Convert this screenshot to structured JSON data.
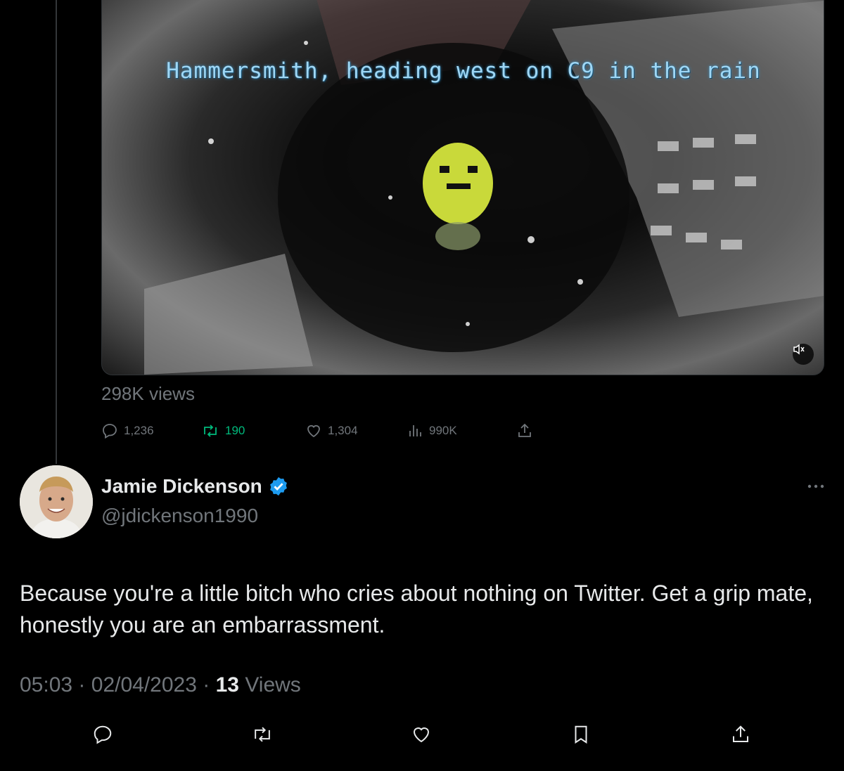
{
  "video": {
    "caption": "Hammersmith, heading west on C9 in the rain",
    "views": "298K views",
    "icons": [
      "volume-mute-icon"
    ]
  },
  "quoted_actions": {
    "replies": "1,236",
    "retweets": "190",
    "likes": "1,304",
    "analytics": "990K"
  },
  "reply": {
    "name": "Jamie Dickenson",
    "handle": "@jdickenson1990",
    "text": "Because you're a little bitch who cries about nothing on Twitter. Get a grip mate, honestly you are an embarrassment.",
    "time": "05:03",
    "date": "02/04/2023",
    "view_count": "13",
    "views_label": "Views",
    "separator": "·"
  },
  "colors": {
    "background": "#000000",
    "text": "#e7e9ea",
    "muted": "#71767b",
    "retweet_green": "#00ba7c",
    "verified_blue": "#1d9bf0"
  }
}
